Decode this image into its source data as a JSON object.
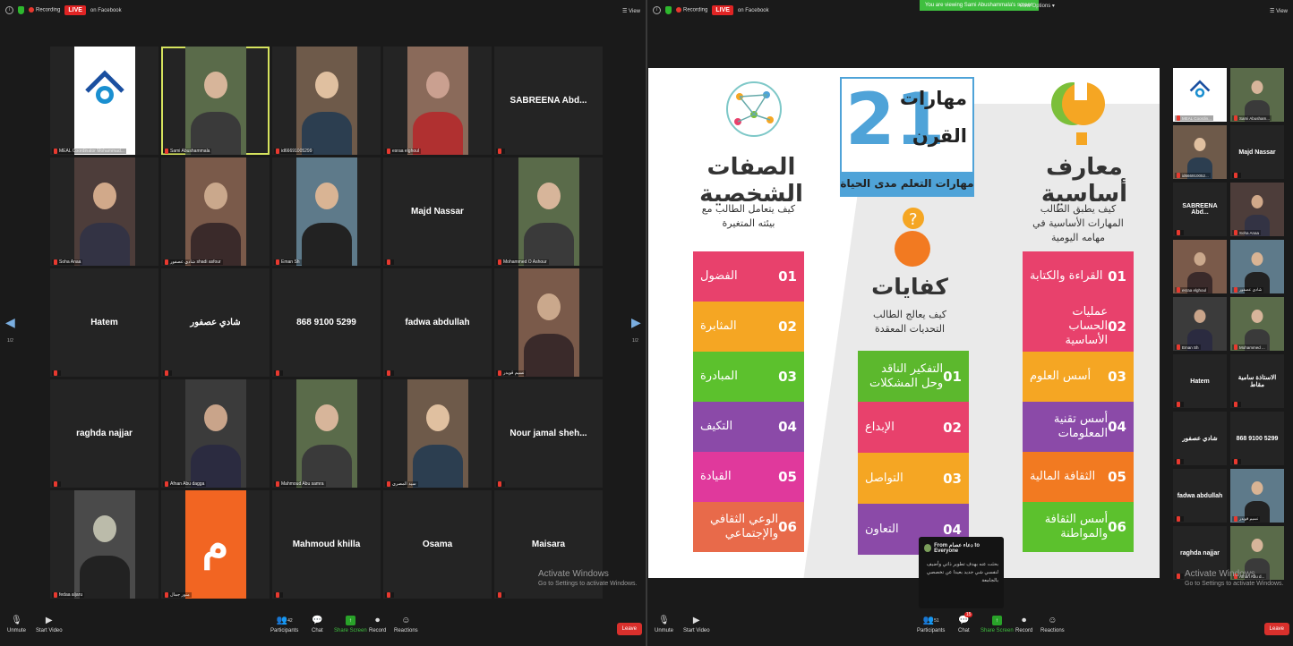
{
  "left": {
    "topbar": {
      "info_icon": "info-icon",
      "recording": "Recording",
      "live": "LIVE",
      "live_on": "on Facebook",
      "view": "View"
    },
    "page_left": "1/2",
    "page_right": "1/2",
    "tiles": [
      {
        "name": "",
        "label": "MEAL Coordinator Mohammad...",
        "kind": "logo"
      },
      {
        "name": "",
        "label": "Sami Abushammala",
        "kind": "photo",
        "active": true
      },
      {
        "name": "",
        "label": "id66691005299",
        "kind": "photo"
      },
      {
        "name": "",
        "label": "esraa elghoul",
        "kind": "photo"
      },
      {
        "name": "SABREENA Abd...",
        "label": "",
        "kind": "text"
      },
      {
        "name": "",
        "label": "Soha Anaa",
        "kind": "photo"
      },
      {
        "name": "",
        "label": "شادي عصفور shadi asfour",
        "kind": "photo"
      },
      {
        "name": "",
        "label": "Eman Sh",
        "kind": "photo"
      },
      {
        "name": "Majd Nassar",
        "label": "",
        "kind": "text"
      },
      {
        "name": "",
        "label": "Mohammed O Ashour",
        "kind": "photo"
      },
      {
        "name": "Hatem",
        "label": "",
        "kind": "text"
      },
      {
        "name": "شادي عصفور",
        "label": "",
        "kind": "text"
      },
      {
        "name": "868 9100 5299",
        "label": "",
        "kind": "text"
      },
      {
        "name": "fadwa abdullah",
        "label": "",
        "kind": "text"
      },
      {
        "name": "",
        "label": "نسيم قويدر",
        "kind": "photo"
      },
      {
        "name": "raghda najjar",
        "label": "",
        "kind": "text"
      },
      {
        "name": "",
        "label": "Afnan Abu dagga",
        "kind": "photo"
      },
      {
        "name": "",
        "label": "Mahmoud Abu samra",
        "kind": "photo"
      },
      {
        "name": "",
        "label": "سيد المصري",
        "kind": "photo"
      },
      {
        "name": "Nour jamal sheh...",
        "label": "",
        "kind": "text"
      },
      {
        "name": "",
        "label": "fedaa aljaru",
        "kind": "photo"
      },
      {
        "name": "م",
        "label": "منور جمال",
        "kind": "initial"
      },
      {
        "name": "Mahmoud khilla",
        "label": "",
        "kind": "text"
      },
      {
        "name": "Osama",
        "label": "",
        "kind": "text"
      },
      {
        "name": "Maisara",
        "label": "",
        "kind": "text"
      }
    ],
    "watermark": {
      "title": "Activate Windows",
      "sub": "Go to Settings to activate Windows."
    },
    "bottom": {
      "unmute": "Unmute",
      "start_video": "Start Video",
      "participants": "Participants",
      "participants_count": "42",
      "chat": "Chat",
      "share_screen": "Share Screen",
      "record": "Record",
      "reactions": "Reactions",
      "leave": "Leave"
    }
  },
  "right": {
    "topbar": {
      "recording": "Recording",
      "live": "LIVE",
      "live_on": "on Facebook",
      "view": "View"
    },
    "viewing": "You are viewing Sami Abushammala's screen",
    "view_options": "View Options ▾",
    "slide": {
      "title_21": "21",
      "title_word1": "مهارات",
      "title_word2": "القرن",
      "title_sub": "مهارات التعلم مدى الحياة",
      "right_col": {
        "title": "معارف أساسية",
        "sub": "كيف يطبق الطالب المهارات الأساسية في مهامه اليومية",
        "items": [
          {
            "num": "01",
            "label": "القراءة والكتابة",
            "color": "#e8416c"
          },
          {
            "num": "02",
            "label": "عمليات الحساب الأساسية",
            "color": "#e8416c"
          },
          {
            "num": "03",
            "label": "أسس العلوم",
            "color": "#f5a623"
          },
          {
            "num": "04",
            "label": "أسس تقنية المعلومات",
            "color": "#8b4aa8"
          },
          {
            "num": "05",
            "label": "الثقافة المالية",
            "color": "#f27a21"
          },
          {
            "num": "06",
            "label": "أسس الثقافة والمواطنة",
            "color": "#5cc12d"
          }
        ]
      },
      "mid_col": {
        "title": "كفايات",
        "sub": "كيف يعالج الطالب التحديات المعقدة",
        "items": [
          {
            "num": "01",
            "label": "التفكير الناقد وحل المشكلات",
            "color": "#5cb82d"
          },
          {
            "num": "02",
            "label": "الإبداع",
            "color": "#e8416c"
          },
          {
            "num": "03",
            "label": "التواصل",
            "color": "#f5a623"
          },
          {
            "num": "04",
            "label": "التعاون",
            "color": "#8b4aa8"
          }
        ]
      },
      "left_col": {
        "title": "الصفات الشخصية",
        "sub": "كيف يتعامل الطالب مع بيئته المتغيرة",
        "items": [
          {
            "num": "01",
            "label": "الفضول",
            "color": "#e8416c"
          },
          {
            "num": "02",
            "label": "المثابرة",
            "color": "#f5a623"
          },
          {
            "num": "03",
            "label": "المبادرة",
            "color": "#5cc12d"
          },
          {
            "num": "04",
            "label": "التكيف",
            "color": "#8b4aa8"
          },
          {
            "num": "05",
            "label": "القيادة",
            "color": "#e0399c"
          },
          {
            "num": "06",
            "label": "الوعي الثقافي والإجتماعي",
            "color": "#e86a4a"
          }
        ]
      }
    },
    "side_tiles": [
      {
        "name": "",
        "label": "MEAL Coordin...",
        "kind": "logo"
      },
      {
        "name": "",
        "label": "Sami Abusham...",
        "kind": "photo"
      },
      {
        "name": "",
        "label": "id666910052...",
        "kind": "photo"
      },
      {
        "name": "Majd Nassar",
        "label": "",
        "kind": "text"
      },
      {
        "name": "SABREENA Abd...",
        "label": "",
        "kind": "text"
      },
      {
        "name": "",
        "label": "Soha Anaa",
        "kind": "photo"
      },
      {
        "name": "",
        "label": "esraa elghoul",
        "kind": "photo",
        "active": true
      },
      {
        "name": "",
        "label": "شادي عصفور",
        "kind": "photo"
      },
      {
        "name": "",
        "label": "Eman Sh",
        "kind": "photo"
      },
      {
        "name": "",
        "label": "Mohammed ...",
        "kind": "photo"
      },
      {
        "name": "Hatem",
        "label": "",
        "kind": "text"
      },
      {
        "name": "الاستاذة سامية مقاط",
        "label": "",
        "kind": "text"
      },
      {
        "name": "شادي عصفور",
        "label": "",
        "kind": "text"
      },
      {
        "name": "868 9100 5299",
        "label": "",
        "kind": "text"
      },
      {
        "name": "fadwa abdullah",
        "label": "",
        "kind": "text"
      },
      {
        "name": "",
        "label": "نسيم قويدر",
        "kind": "photo"
      },
      {
        "name": "raghda najjar",
        "label": "",
        "kind": "text"
      },
      {
        "name": "",
        "label": "Afnan Abu d...",
        "kind": "photo"
      }
    ],
    "chat_popup": {
      "from": "From دعاء عصام to Everyone",
      "message": "بحثت عنه بهدف تطوير ذاتي وأضيف لنفسي شي جديد بعيدا عن تخصصي بالجامعة"
    },
    "watermark": {
      "title": "Activate Windows",
      "sub": "Go to Settings to activate Windows."
    },
    "bottom": {
      "unmute": "Unmute",
      "start_video": "Start Video",
      "participants": "Participants",
      "participants_count": "51",
      "chat": "Chat",
      "chat_badge": "15",
      "share_screen": "Share Screen",
      "record": "Record",
      "reactions": "Reactions",
      "leave": "Leave"
    }
  }
}
